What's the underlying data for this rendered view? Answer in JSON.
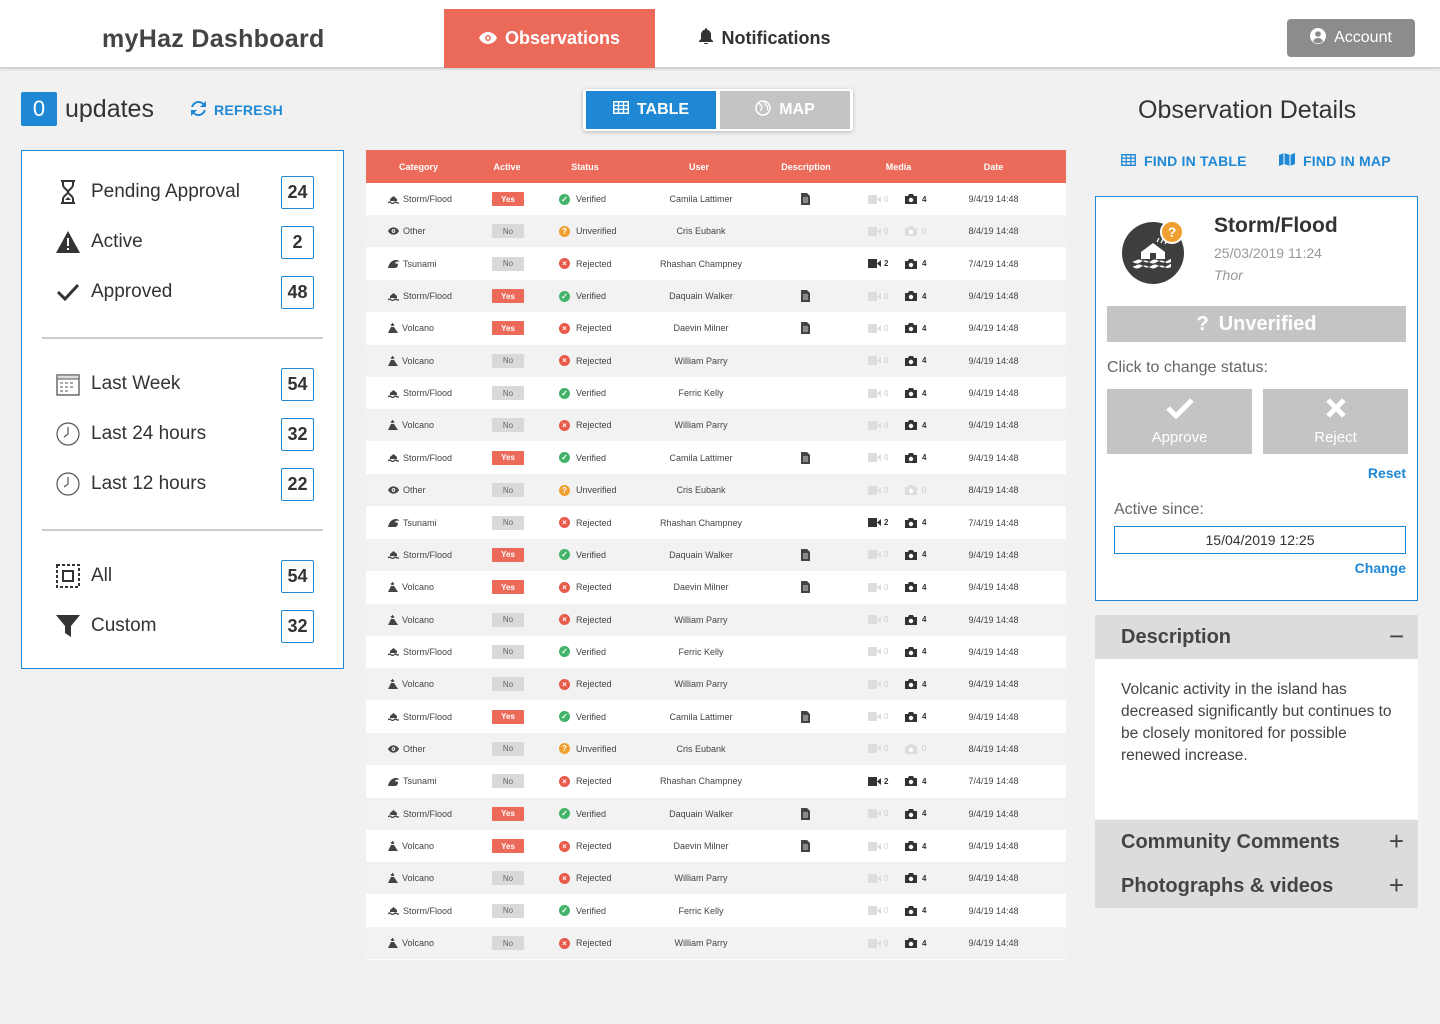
{
  "header": {
    "brand": "myHaz Dashboard",
    "tabs": [
      {
        "label": "Observations",
        "icon": "eye-icon",
        "active": true
      },
      {
        "label": "Notifications",
        "icon": "bell-icon",
        "active": false
      }
    ],
    "account_label": "Account",
    "accent": "#ec6a5a",
    "primary": "#1e88d4"
  },
  "updates": {
    "count": "0",
    "label": "updates",
    "refresh_label": "REFRESH"
  },
  "filters": {
    "status": [
      {
        "label": "Pending Approval",
        "count": "24",
        "icon": "hourglass-icon"
      },
      {
        "label": "Active",
        "count": "2",
        "icon": "warning-icon"
      },
      {
        "label": "Approved",
        "count": "48",
        "icon": "check-icon"
      }
    ],
    "time": [
      {
        "label": "Last Week",
        "count": "54",
        "icon": "calendar-icon"
      },
      {
        "label": "Last 24 hours",
        "count": "32",
        "icon": "clock-icon"
      },
      {
        "label": "Last 12 hours",
        "count": "22",
        "icon": "clock-icon"
      }
    ],
    "scope": [
      {
        "label": "All",
        "count": "54",
        "icon": "select-all-icon"
      },
      {
        "label": "Custom",
        "count": "32",
        "icon": "filter-icon"
      }
    ]
  },
  "view_toggle": {
    "table_label": "TABLE",
    "map_label": "MAP",
    "selected": "TABLE"
  },
  "table": {
    "columns": [
      "Category",
      "Active",
      "Status",
      "User",
      "Description",
      "Media",
      "Date"
    ],
    "rows": [
      {
        "category": "Storm/Flood",
        "active": "Yes",
        "status": "Verified",
        "user": "Camila Lattimer",
        "desc": true,
        "video": "0",
        "photo": "4",
        "date": "9/4/19 14:48"
      },
      {
        "category": "Other",
        "active": "No",
        "status": "Unverified",
        "user": "Cris Eubank",
        "desc": false,
        "video": "0",
        "photo": "0",
        "date": "8/4/19 14:48"
      },
      {
        "category": "Tsunami",
        "active": "No",
        "status": "Rejected",
        "user": "Rhashan Champney",
        "desc": false,
        "video": "2",
        "photo": "4",
        "date": "7/4/19 14:48"
      },
      {
        "category": "Storm/Flood",
        "active": "Yes",
        "status": "Verified",
        "user": "Daquain Walker",
        "desc": true,
        "video": "0",
        "photo": "4",
        "date": "9/4/19 14:48"
      },
      {
        "category": "Volcano",
        "active": "Yes",
        "status": "Rejected",
        "user": "Daevin Milner",
        "desc": true,
        "video": "0",
        "photo": "4",
        "date": "9/4/19 14:48"
      },
      {
        "category": "Volcano",
        "active": "No",
        "status": "Rejected",
        "user": "William Parry",
        "desc": false,
        "video": "0",
        "photo": "4",
        "date": "9/4/19 14:48"
      },
      {
        "category": "Storm/Flood",
        "active": "No",
        "status": "Verified",
        "user": "Ferric Kelly",
        "desc": false,
        "video": "0",
        "photo": "4",
        "date": "9/4/19 14:48"
      },
      {
        "category": "Volcano",
        "active": "No",
        "status": "Rejected",
        "user": "William Parry",
        "desc": false,
        "video": "0",
        "photo": "4",
        "date": "9/4/19 14:48"
      },
      {
        "category": "Storm/Flood",
        "active": "Yes",
        "status": "Verified",
        "user": "Camila Lattimer",
        "desc": true,
        "video": "0",
        "photo": "4",
        "date": "9/4/19 14:48"
      },
      {
        "category": "Other",
        "active": "No",
        "status": "Unverified",
        "user": "Cris Eubank",
        "desc": false,
        "video": "0",
        "photo": "0",
        "date": "8/4/19 14:48"
      },
      {
        "category": "Tsunami",
        "active": "No",
        "status": "Rejected",
        "user": "Rhashan Champney",
        "desc": false,
        "video": "2",
        "photo": "4",
        "date": "7/4/19 14:48"
      },
      {
        "category": "Storm/Flood",
        "active": "Yes",
        "status": "Verified",
        "user": "Daquain Walker",
        "desc": true,
        "video": "0",
        "photo": "4",
        "date": "9/4/19 14:48"
      },
      {
        "category": "Volcano",
        "active": "Yes",
        "status": "Rejected",
        "user": "Daevin Milner",
        "desc": true,
        "video": "0",
        "photo": "4",
        "date": "9/4/19 14:48"
      },
      {
        "category": "Volcano",
        "active": "No",
        "status": "Rejected",
        "user": "William Parry",
        "desc": false,
        "video": "0",
        "photo": "4",
        "date": "9/4/19 14:48"
      },
      {
        "category": "Storm/Flood",
        "active": "No",
        "status": "Verified",
        "user": "Ferric Kelly",
        "desc": false,
        "video": "0",
        "photo": "4",
        "date": "9/4/19 14:48"
      },
      {
        "category": "Volcano",
        "active": "No",
        "status": "Rejected",
        "user": "William Parry",
        "desc": false,
        "video": "0",
        "photo": "4",
        "date": "9/4/19 14:48"
      },
      {
        "category": "Storm/Flood",
        "active": "Yes",
        "status": "Verified",
        "user": "Camila Lattimer",
        "desc": true,
        "video": "0",
        "photo": "4",
        "date": "9/4/19 14:48"
      },
      {
        "category": "Other",
        "active": "No",
        "status": "Unverified",
        "user": "Cris Eubank",
        "desc": false,
        "video": "0",
        "photo": "0",
        "date": "8/4/19 14:48"
      },
      {
        "category": "Tsunami",
        "active": "No",
        "status": "Rejected",
        "user": "Rhashan Champney",
        "desc": false,
        "video": "2",
        "photo": "4",
        "date": "7/4/19 14:48"
      },
      {
        "category": "Storm/Flood",
        "active": "Yes",
        "status": "Verified",
        "user": "Daquain Walker",
        "desc": true,
        "video": "0",
        "photo": "4",
        "date": "9/4/19 14:48"
      },
      {
        "category": "Volcano",
        "active": "Yes",
        "status": "Rejected",
        "user": "Daevin Milner",
        "desc": true,
        "video": "0",
        "photo": "4",
        "date": "9/4/19 14:48"
      },
      {
        "category": "Volcano",
        "active": "No",
        "status": "Rejected",
        "user": "William Parry",
        "desc": false,
        "video": "0",
        "photo": "4",
        "date": "9/4/19 14:48"
      },
      {
        "category": "Storm/Flood",
        "active": "No",
        "status": "Verified",
        "user": "Ferric Kelly",
        "desc": false,
        "video": "0",
        "photo": "4",
        "date": "9/4/19 14:48"
      },
      {
        "category": "Volcano",
        "active": "No",
        "status": "Rejected",
        "user": "William Parry",
        "desc": false,
        "video": "0",
        "photo": "4",
        "date": "9/4/19 14:48"
      }
    ]
  },
  "details": {
    "title": "Observation Details",
    "find_in_table": "FIND IN TABLE",
    "find_in_map": "FIND IN MAP",
    "category": "Storm/Flood",
    "date": "25/03/2019 11:24",
    "user": "Thor",
    "status": "Unverified",
    "click_to_change": "Click to change status:",
    "approve": "Approve",
    "reject": "Reject",
    "reset": "Reset",
    "active_since_label": "Active since:",
    "active_since_value": "15/04/2019 12:25",
    "change": "Change"
  },
  "accordion": {
    "description": {
      "title": "Description",
      "expanded": true,
      "body": "Volcanic activity in the island has decreased significantly but continues to be closely monitored for possible renewed increase."
    },
    "comments": {
      "title": "Community Comments",
      "expanded": false
    },
    "media": {
      "title": "Photographs & videos",
      "expanded": false
    }
  }
}
